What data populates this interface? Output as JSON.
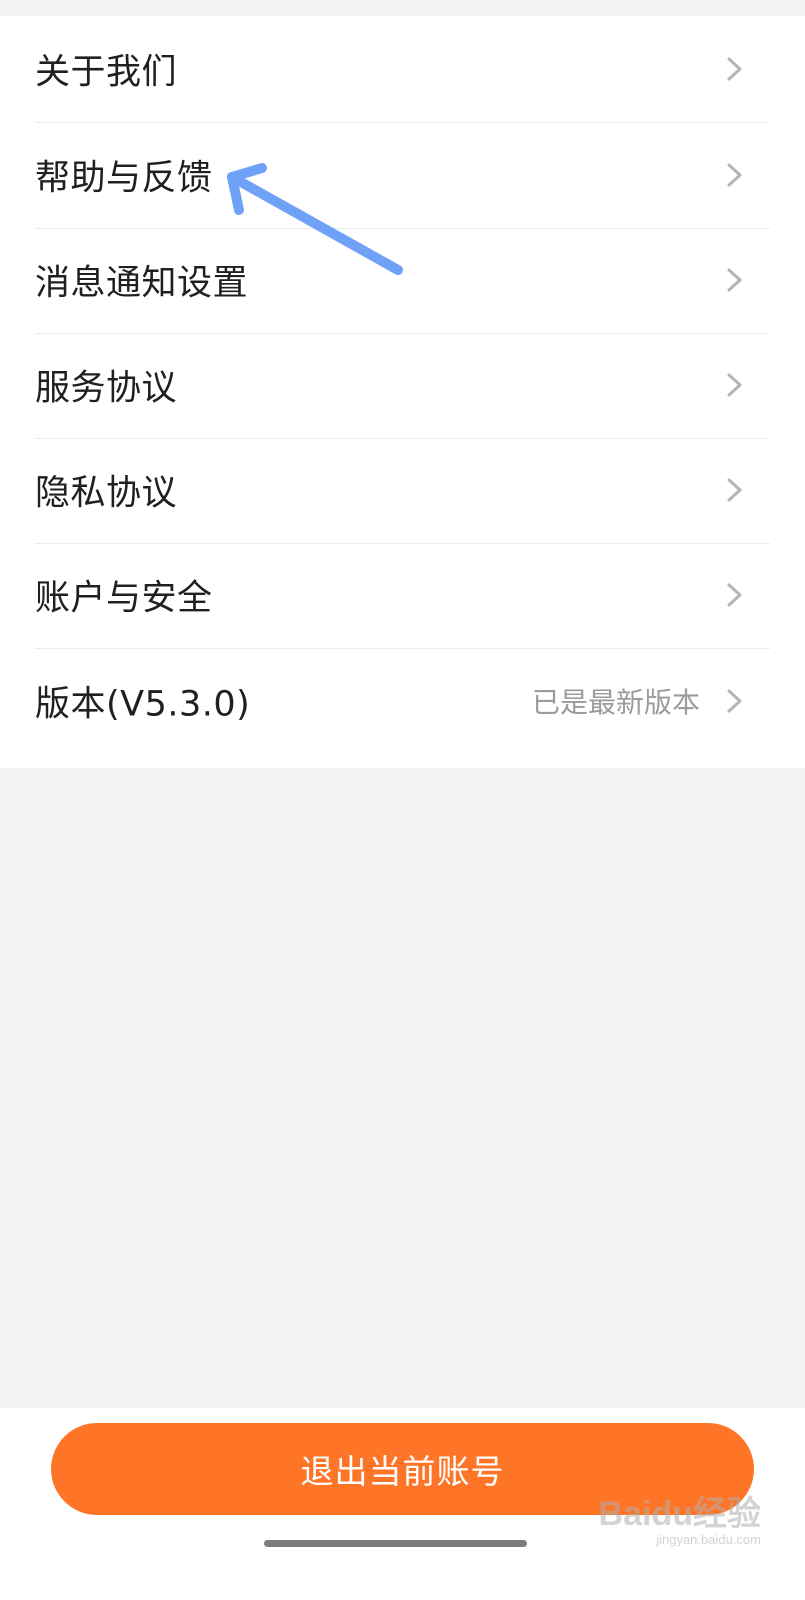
{
  "settings": {
    "items": [
      {
        "label": "关于我们",
        "value": ""
      },
      {
        "label": "帮助与反馈",
        "value": ""
      },
      {
        "label": "消息通知设置",
        "value": ""
      },
      {
        "label": "服务协议",
        "value": ""
      },
      {
        "label": "隐私协议",
        "value": ""
      },
      {
        "label": "账户与安全",
        "value": ""
      },
      {
        "label": "版本(V5.3.0)",
        "value": "已是最新版本"
      }
    ]
  },
  "footer": {
    "logout_label": "退出当前账号"
  },
  "watermark": {
    "main": "Baidu经验",
    "sub": "jingyan.baidu.com"
  },
  "colors": {
    "accent": "#ff7527",
    "arrow": "#6fa2f7",
    "page_background": "#f4f4f4",
    "list_background": "#ffffff",
    "divider": "#ececec",
    "label_text": "#202020",
    "secondary_text": "#9b9b9b"
  },
  "icons": {
    "row_chevron": "chevron-right-icon",
    "annotation": "annotation-arrow-icon"
  }
}
